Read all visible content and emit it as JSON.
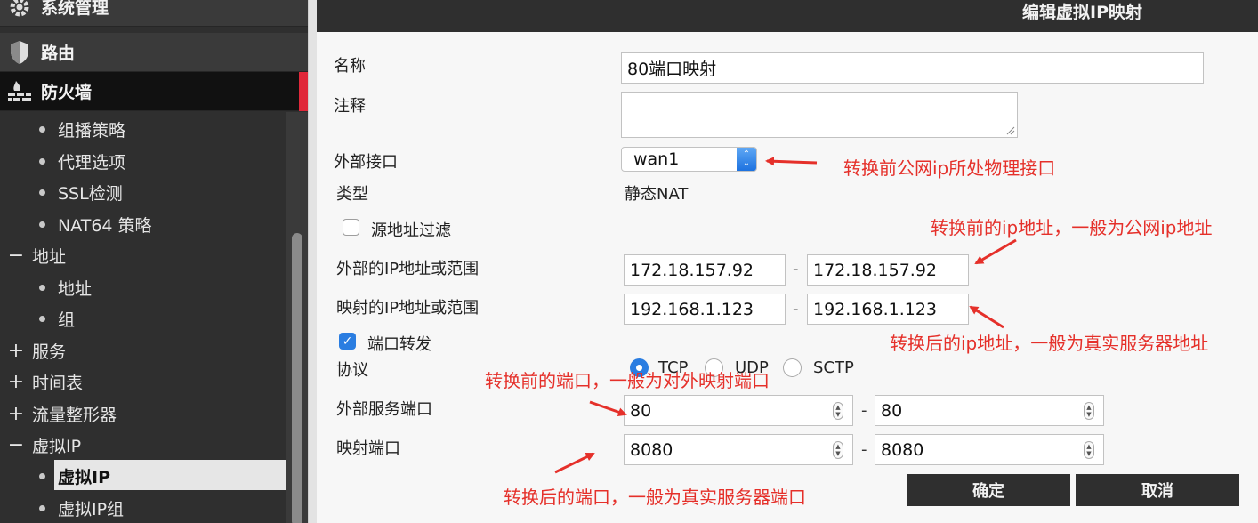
{
  "sidebar": {
    "top_items": [
      {
        "label": "系统管理",
        "icon": "gear-icon"
      },
      {
        "label": "路由",
        "icon": "shield-icon"
      },
      {
        "label": "防火墙",
        "icon": "firewall-icon"
      }
    ],
    "firewall_children": [
      "组播策略",
      "代理选项",
      "SSL检测",
      "NAT64 策略"
    ],
    "address_group": {
      "label": "地址",
      "toggle": "−",
      "children": [
        "地址",
        "组"
      ]
    },
    "service_group": {
      "label": "服务",
      "toggle": "+"
    },
    "schedule_group": {
      "label": "时间表",
      "toggle": "+"
    },
    "shaper_group": {
      "label": "流量整形器",
      "toggle": "+"
    },
    "vip_group": {
      "label": "虚拟IP",
      "toggle": "−",
      "children": [
        "虚拟IP",
        "虚拟IP组"
      ]
    }
  },
  "titlebar": {
    "title": "编辑虚拟IP映射"
  },
  "form": {
    "name_label": "名称",
    "name_value": "80端口映射",
    "comment_label": "注释",
    "comment_value": "",
    "ext_interface_label": "外部接口",
    "ext_interface_value": "wan1",
    "type_label": "类型",
    "type_value": "静态NAT",
    "src_filter_label": "源地址过滤",
    "src_filter_checked": false,
    "ext_ip_label": "外部的IP地址或范围",
    "ext_ip_start": "172.18.157.92",
    "ext_ip_end": "172.18.157.92",
    "mapped_ip_label": "映射的IP地址或范围",
    "mapped_ip_start": "192.168.1.123",
    "mapped_ip_end": "192.168.1.123",
    "port_forward_label": "端口转发",
    "port_forward_checked": true,
    "protocol_label": "协议",
    "protocols": [
      "TCP",
      "UDP",
      "SCTP"
    ],
    "protocol_selected": "TCP",
    "ext_port_label": "外部服务端口",
    "ext_port_start": "80",
    "ext_port_end": "80",
    "mapped_port_label": "映射端口",
    "mapped_port_start": "8080",
    "mapped_port_end": "8080",
    "range_dash": "-",
    "ok_label": "确定",
    "cancel_label": "取消"
  },
  "annotations": {
    "ext_interface": "转换前公网ip所处物理接口",
    "ext_ip": "转换前的ip地址，一般为公网ip地址",
    "mapped_ip": "转换后的ip地址，一般为真实服务器地址",
    "ext_port": "转换前的端口，一般为对外映射端口",
    "mapped_port": "转换后的端口，一般为真实服务器端口",
    "color": "#e5302a"
  }
}
